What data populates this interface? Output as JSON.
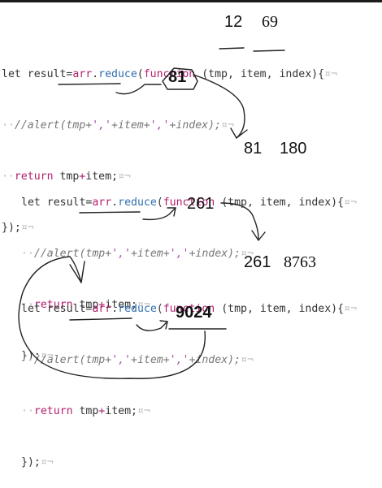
{
  "code": {
    "line1": {
      "prefix": "let result=",
      "arr": "arr",
      "dot": ".",
      "reduce": "reduce",
      "open": "(",
      "function_kw": "function",
      "params": " (tmp, item, index){",
      "pilcrow": "¤¬"
    },
    "line2": {
      "indent": "··",
      "comment_start": "//alert(tmp+",
      "str1": "','",
      "mid1": "+item+",
      "str2": "','",
      "mid2": "+index);",
      "pilcrow": "¤¬"
    },
    "line3": {
      "indent": "··",
      "return_kw": "return",
      "expr_a": " tmp",
      "plus": "+",
      "expr_b": "item;",
      "pilcrow": "¤¬"
    },
    "line4": {
      "text": "});",
      "pilcrow": "¤¬"
    }
  },
  "annotations": {
    "block1": {
      "tmp_value": "12",
      "item_value": "69",
      "result": "81"
    },
    "block2": {
      "tmp_value": "81",
      "item_value": "180",
      "result": "261"
    },
    "block3": {
      "tmp_value": "261",
      "item_value": "8763",
      "result": "9024"
    }
  },
  "colors": {
    "keyword": "#b21e6f",
    "function_name": "#2f6fb0",
    "comment": "#777777",
    "string": "#a04da0",
    "ink": "#222222"
  }
}
